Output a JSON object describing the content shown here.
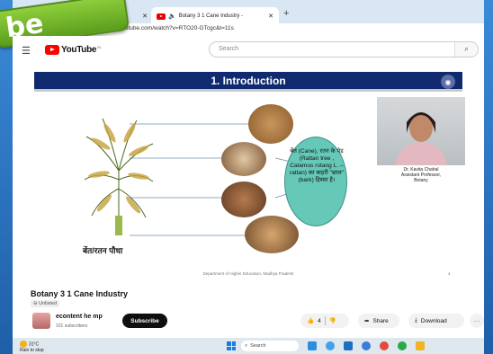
{
  "browser": {
    "tabs": [
      {
        "label": "Botany 3 1 Cane Industry -",
        "active": true
      }
    ],
    "url": "youtube.com/watch?v=RTO20-GTcgc&t=11s"
  },
  "overlay_label": "be",
  "youtube": {
    "logo_text": "YouTube",
    "logo_suffix": "IN",
    "search_placeholder": "Search"
  },
  "slide": {
    "title": "1. Introduction",
    "plant_caption": "बेंत/रतन पौधा",
    "bubble_text": "बेंत (Cane), रतन के पेड़ (Rattan tree , Calamus rotang L. – rattan) का बाहरी \"छाल\" (bark) हिस्सा है।",
    "presenter_name": "Dr. Kavita Chahal",
    "presenter_title1": "Assistant Professor,",
    "presenter_title2": "Botany",
    "footer": "Department of Higher Education, Madhya Pradesh",
    "page_number": "4"
  },
  "video_info": {
    "title": "Botany 3 1 Cane Industry",
    "visibility": "Unlisted",
    "channel_name": "econtent he mp",
    "subscribers": "101 subscribers",
    "subscribe_label": "Subscribe",
    "like_count": "4",
    "share_label": "Share",
    "download_label": "Download",
    "more_label": "···"
  },
  "taskbar": {
    "temperature": "31°C",
    "weather": "Rain to stop",
    "search_label": "Search"
  },
  "colors": {
    "slide_bar": "#0f2a6e",
    "bubble": "#66c9b8",
    "youtube_red": "#ff0000"
  }
}
